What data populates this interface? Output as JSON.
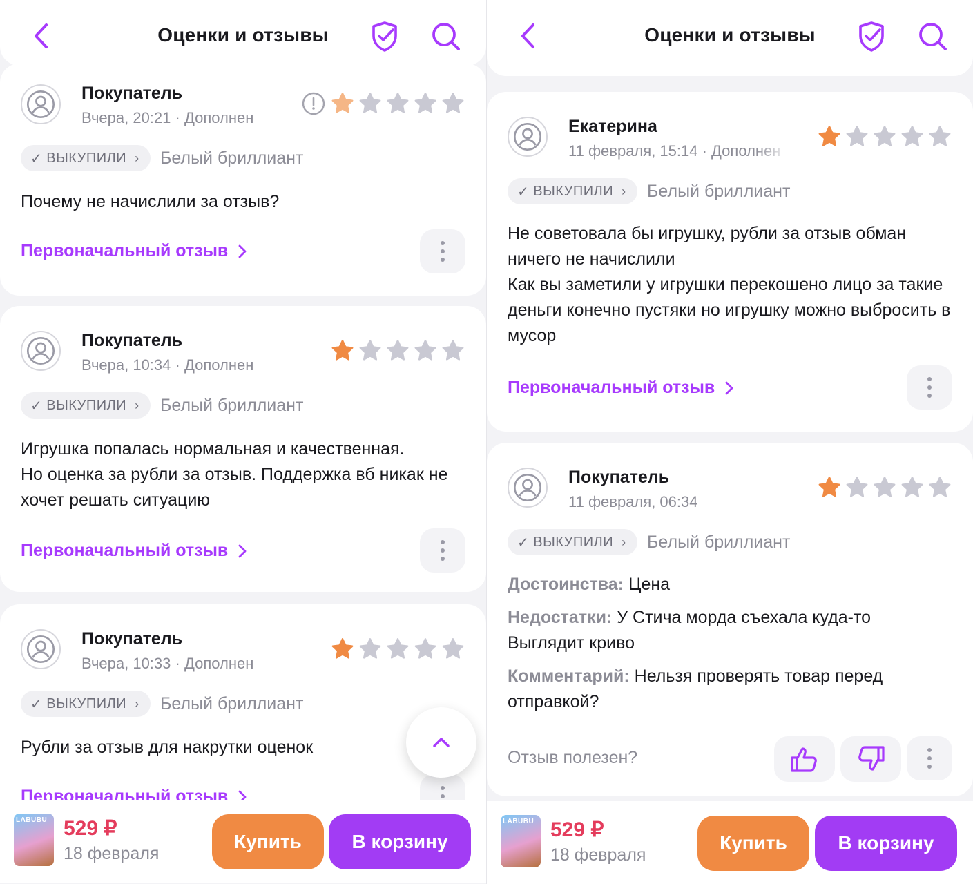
{
  "colors": {
    "accent": "#a73afd",
    "star_active": "#f08a43",
    "star_active_faded": "#f5b686",
    "star_inactive": "#c9c9d3",
    "price": "#e43c5c",
    "buy": "#f08a43",
    "cart": "#a23cf4"
  },
  "left": {
    "header": {
      "title": "Оценки и отзывы",
      "icons": [
        "chevron-left-icon",
        "shield-check-icon",
        "search-icon"
      ]
    },
    "reviews": [
      {
        "author": "Покупатель",
        "date": "Вчера, 20:21 · Дополнен",
        "rating": 1,
        "badge": "ВЫКУПИЛИ",
        "variant": "Белый бриллиант",
        "text": "Почему не начислили за отзыв?",
        "link": "Первоначальный отзыв"
      },
      {
        "author": "Покупатель",
        "date": "Вчера, 10:34 · Дополнен",
        "rating": 1,
        "badge": "ВЫКУПИЛИ",
        "variant": "Белый бриллиант",
        "text": "Игрушка попалась нормальная и качественная.\nНо оценка за рубли за отзыв. Поддержка вб никак не хочет решать ситуацию",
        "link": "Первоначальный отзыв"
      },
      {
        "author": "Покупатель",
        "date": "Вчера, 10:33 · Дополнен",
        "rating": 1,
        "badge": "ВЫКУПИЛИ",
        "variant": "Белый бриллиант",
        "text": "Рубли за отзыв для накрутки оценок",
        "link": "Первоначальный отзыв"
      }
    ],
    "bottom": {
      "thumb_label": "LABUBU",
      "price": "529 ₽",
      "delivery": "18 февраля",
      "buy": "Купить",
      "cart": "В корзину"
    }
  },
  "right": {
    "header": {
      "title": "Оценки и отзывы"
    },
    "reviews": [
      {
        "author": "Екатерина",
        "date": "11 февраля, 15:14 · Дополнен",
        "rating": 1,
        "badge": "ВЫКУПИЛИ",
        "variant": "Белый бриллиант",
        "text": "Не советовала бы игрушку, рубли за отзыв обман ничего не начислили\nКак вы заметили у игрушки перекошено лицо за такие деньги конечно пустяки но игрушку можно выбросить в мусор",
        "link": "Первоначальный отзыв"
      },
      {
        "author": "Покупатель",
        "date": "11 февраля, 06:34",
        "rating": 1,
        "badge": "ВЫКУПИЛИ",
        "variant": "Белый бриллиант",
        "pros_label": "Достоинства:",
        "pros": " Цена",
        "cons_label": "Недостатки:",
        "cons": " У Стича морда съехала куда-то\nВыглядит криво",
        "comment_label": "Комментарий:",
        "comment": " Нельзя проверять товар перед отправкой?",
        "helpful": "Отзыв полезен?"
      }
    ],
    "bottom": {
      "thumb_label": "LABUBU",
      "price": "529 ₽",
      "delivery": "18 февраля",
      "buy": "Купить",
      "cart": "В корзину"
    }
  }
}
